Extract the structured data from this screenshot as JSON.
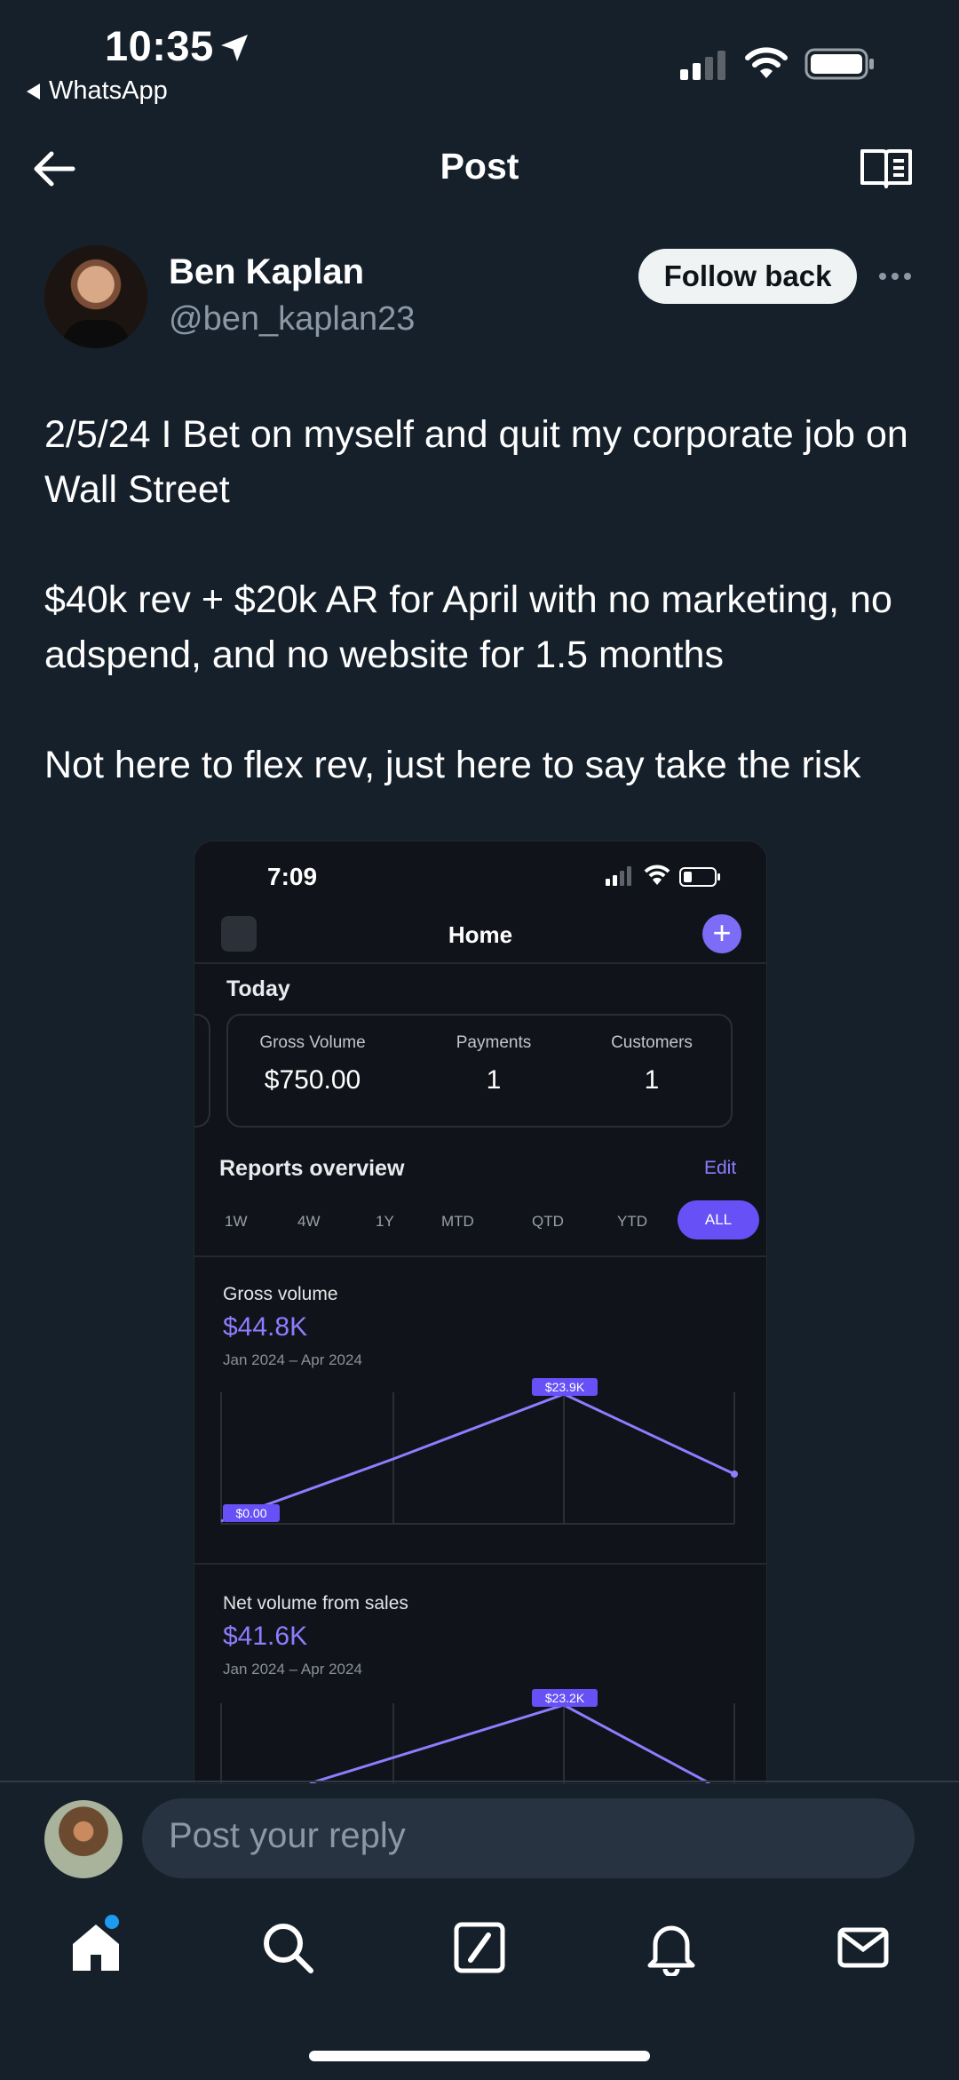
{
  "status_bar": {
    "time": "10:35",
    "back_app": "WhatsApp"
  },
  "header": {
    "title": "Post"
  },
  "author": {
    "name": "Ben Kaplan",
    "handle": "@ben_kaplan23",
    "follow_label": "Follow back"
  },
  "post": {
    "text": "2/5/24 I Bet on myself and quit my corporate job on Wall Street\n\n$40k rev + $20k AR for April with no marketing, no adspend, and no website for 1.5 months\n\nNot here to flex rev, just here to say take the risk"
  },
  "embedded": {
    "time": "7:09",
    "title": "Home",
    "today_label": "Today",
    "stats": [
      {
        "label": "Gross Volume",
        "value": "$750.00"
      },
      {
        "label": "Payments",
        "value": "1"
      },
      {
        "label": "Customers",
        "value": "1"
      }
    ],
    "reports_label": "Reports overview",
    "edit_label": "Edit",
    "ranges": [
      "1W",
      "4W",
      "1Y",
      "MTD",
      "QTD",
      "YTD",
      "ALL"
    ],
    "active_range": "ALL",
    "charts": [
      {
        "title": "Gross volume",
        "value": "$44.8K",
        "range": "Jan 2024 – Apr 2024",
        "start_label": "$0.00",
        "peak_label": "$23.9K"
      },
      {
        "title": "Net volume from sales",
        "value": "$41.6K",
        "range": "Jan 2024 – Apr 2024",
        "peak_label": "$23.2K"
      }
    ]
  },
  "reply": {
    "placeholder": "Post your reply"
  },
  "colors": {
    "background": "#15202b",
    "accent_purple": "#7d6cf5",
    "notification_dot": "#1d9bf0"
  }
}
